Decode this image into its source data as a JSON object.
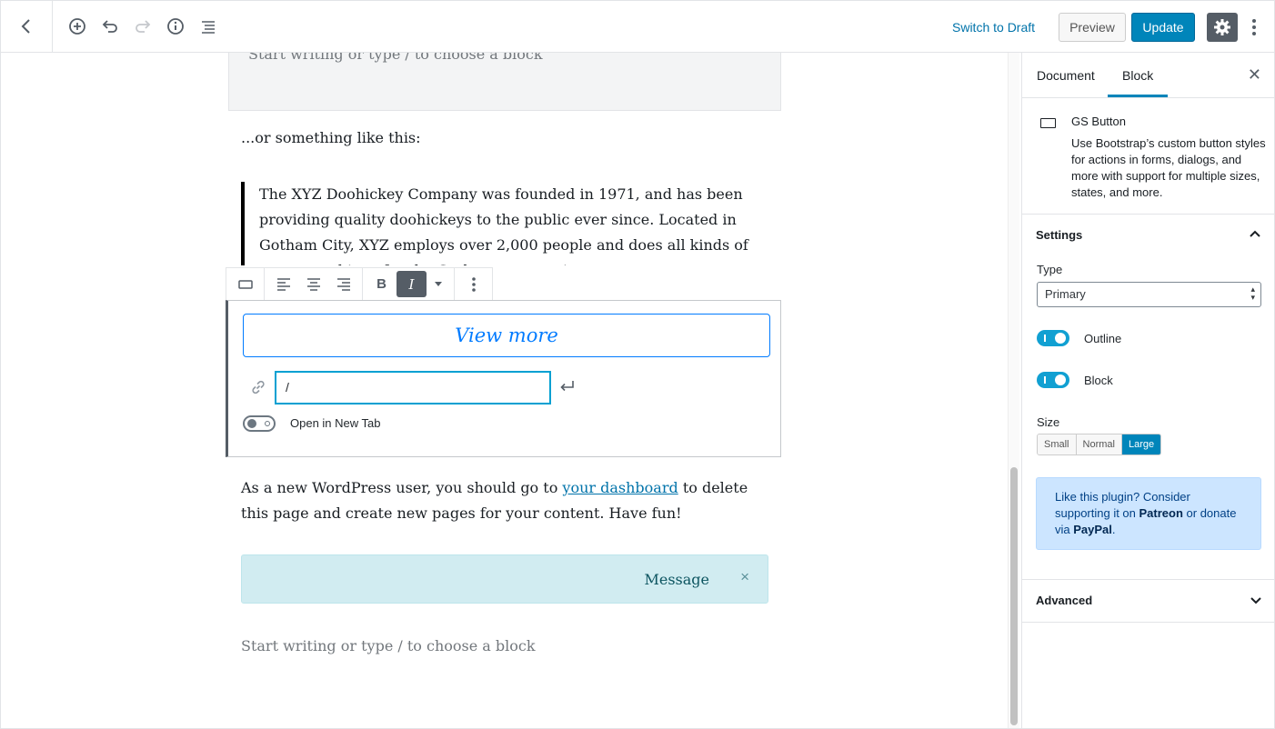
{
  "toolbar": {
    "switch_to_draft": "Switch to Draft",
    "preview": "Preview",
    "update": "Update",
    "icons": [
      "back-arrow-icon",
      "add-block-icon",
      "undo-icon",
      "redo-icon",
      "info-icon",
      "list-view-icon",
      "gear-icon",
      "more-vertical-icon"
    ]
  },
  "editor": {
    "placeholder_top": "Start writing or type / to choose a block",
    "paragraph1": "...or something like this:",
    "quote": "The XYZ Doohickey Company was founded in 1971, and has been providing quality doohickeys to the public ever since. Located in Gotham City, XYZ employs over 2,000 people and does all kinds of awesome things for the Gotham community.",
    "gs_button": {
      "label": "View more",
      "url_value": "/",
      "open_new_tab_label": "Open in New Tab"
    },
    "paragraph2_before": "As a new WordPress user, you should go to ",
    "paragraph2_link": "your dashboard",
    "paragraph2_after": " to delete this page and create new pages for your content. Have fun!",
    "alert_message": "Message",
    "alert_close": "×",
    "placeholder_bottom": "Start writing or type / to choose a block"
  },
  "block_toolbar": {
    "bold": "B",
    "italic": "I"
  },
  "sidebar": {
    "tabs": [
      "Document",
      "Block"
    ],
    "active_tab": "Block",
    "close": "✕",
    "block_name": "GS Button",
    "block_description": "Use Bootstrap’s custom button styles for actions in forms, dialogs, and more with support for multiple sizes, states, and more.",
    "settings_title": "Settings",
    "type_label": "Type",
    "type_value": "Primary",
    "outline_label": "Outline",
    "outline_on": true,
    "block_label": "Block",
    "block_on": true,
    "size_label": "Size",
    "sizes": [
      "Small",
      "Normal",
      "Large"
    ],
    "active_size": "Large",
    "promo": {
      "line1": "Like this plugin? Consider supporting it on ",
      "patreon": "Patreon",
      "line2": " or donate via ",
      "paypal": "PayPal",
      "end": "."
    },
    "advanced_title": "Advanced"
  },
  "colors": {
    "accent": "#0085ba",
    "link": "#0073aa",
    "bootstrap_primary": "#007bff",
    "alert_bg": "#d1ecf1",
    "promo_bg": "#cce5ff",
    "toggle_on": "#11a0d2"
  }
}
